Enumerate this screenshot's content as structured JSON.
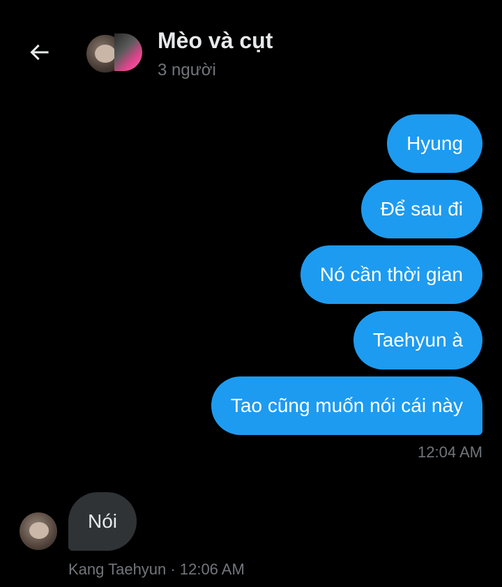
{
  "header": {
    "back_icon": "arrow-left-icon",
    "title": "Mèo và cụt",
    "subtitle": "3 người"
  },
  "messages_outgoing": [
    {
      "text": "Hyung"
    },
    {
      "text": "Để sau đi"
    },
    {
      "text": "Nó cần thời gian"
    },
    {
      "text": "Taehyun à"
    },
    {
      "text": "Tao cũng muốn nói cái này"
    }
  ],
  "outgoing_timestamp": "12:04 AM",
  "incoming_message": {
    "text": "Nói",
    "sender": "Kang Taehyun",
    "separator": "·",
    "time": "12:06 AM"
  },
  "colors": {
    "background": "#000000",
    "outgoing_bubble": "#1d9bf0",
    "incoming_bubble": "#2f3336",
    "secondary_text": "#71767b",
    "primary_text": "#e7e9ea"
  }
}
